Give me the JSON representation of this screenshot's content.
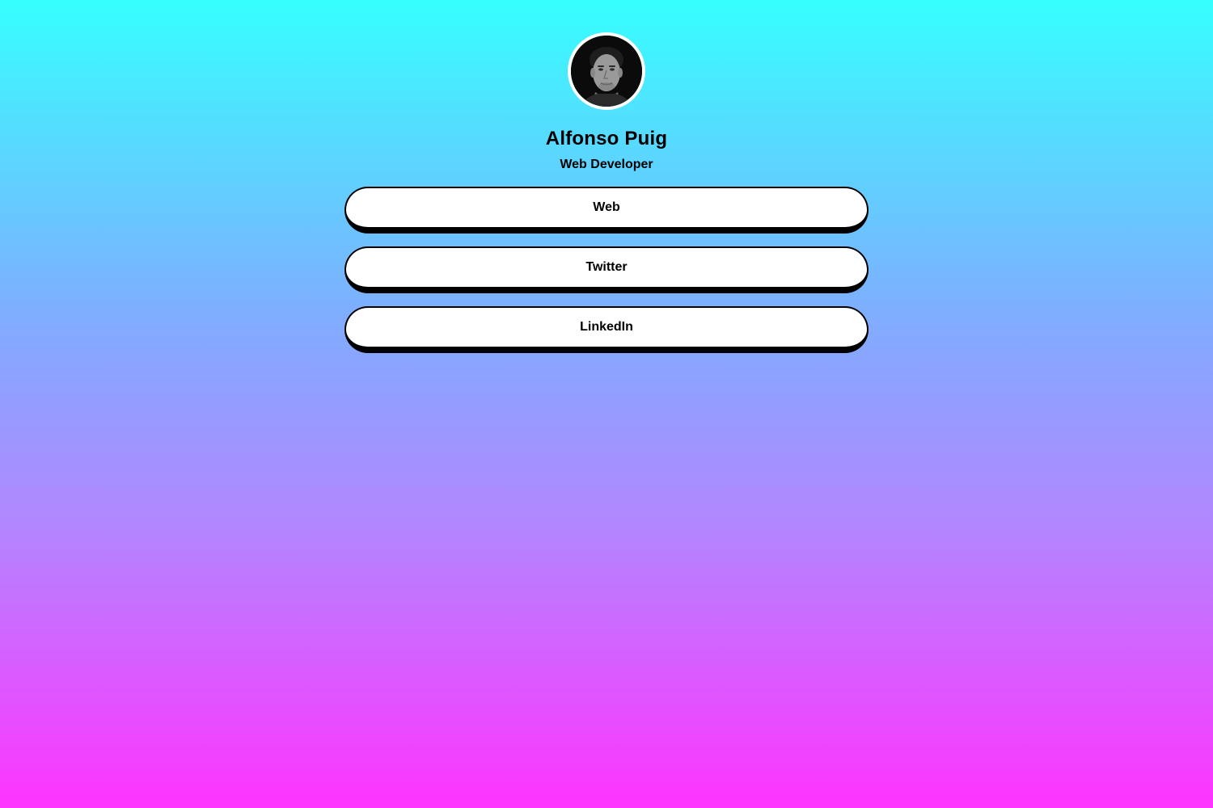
{
  "profile": {
    "name": "Alfonso Puig",
    "title": "Web Developer",
    "avatar_icon": "avatar-photo"
  },
  "links": [
    {
      "label": "Web"
    },
    {
      "label": "Twitter"
    },
    {
      "label": "LinkedIn"
    }
  ],
  "colors": {
    "gradient_top": "#36ffff",
    "gradient_bottom": "#ff33ff",
    "button_bg": "#ffffff",
    "button_border": "#000000",
    "avatar_ring": "#ffffff"
  }
}
